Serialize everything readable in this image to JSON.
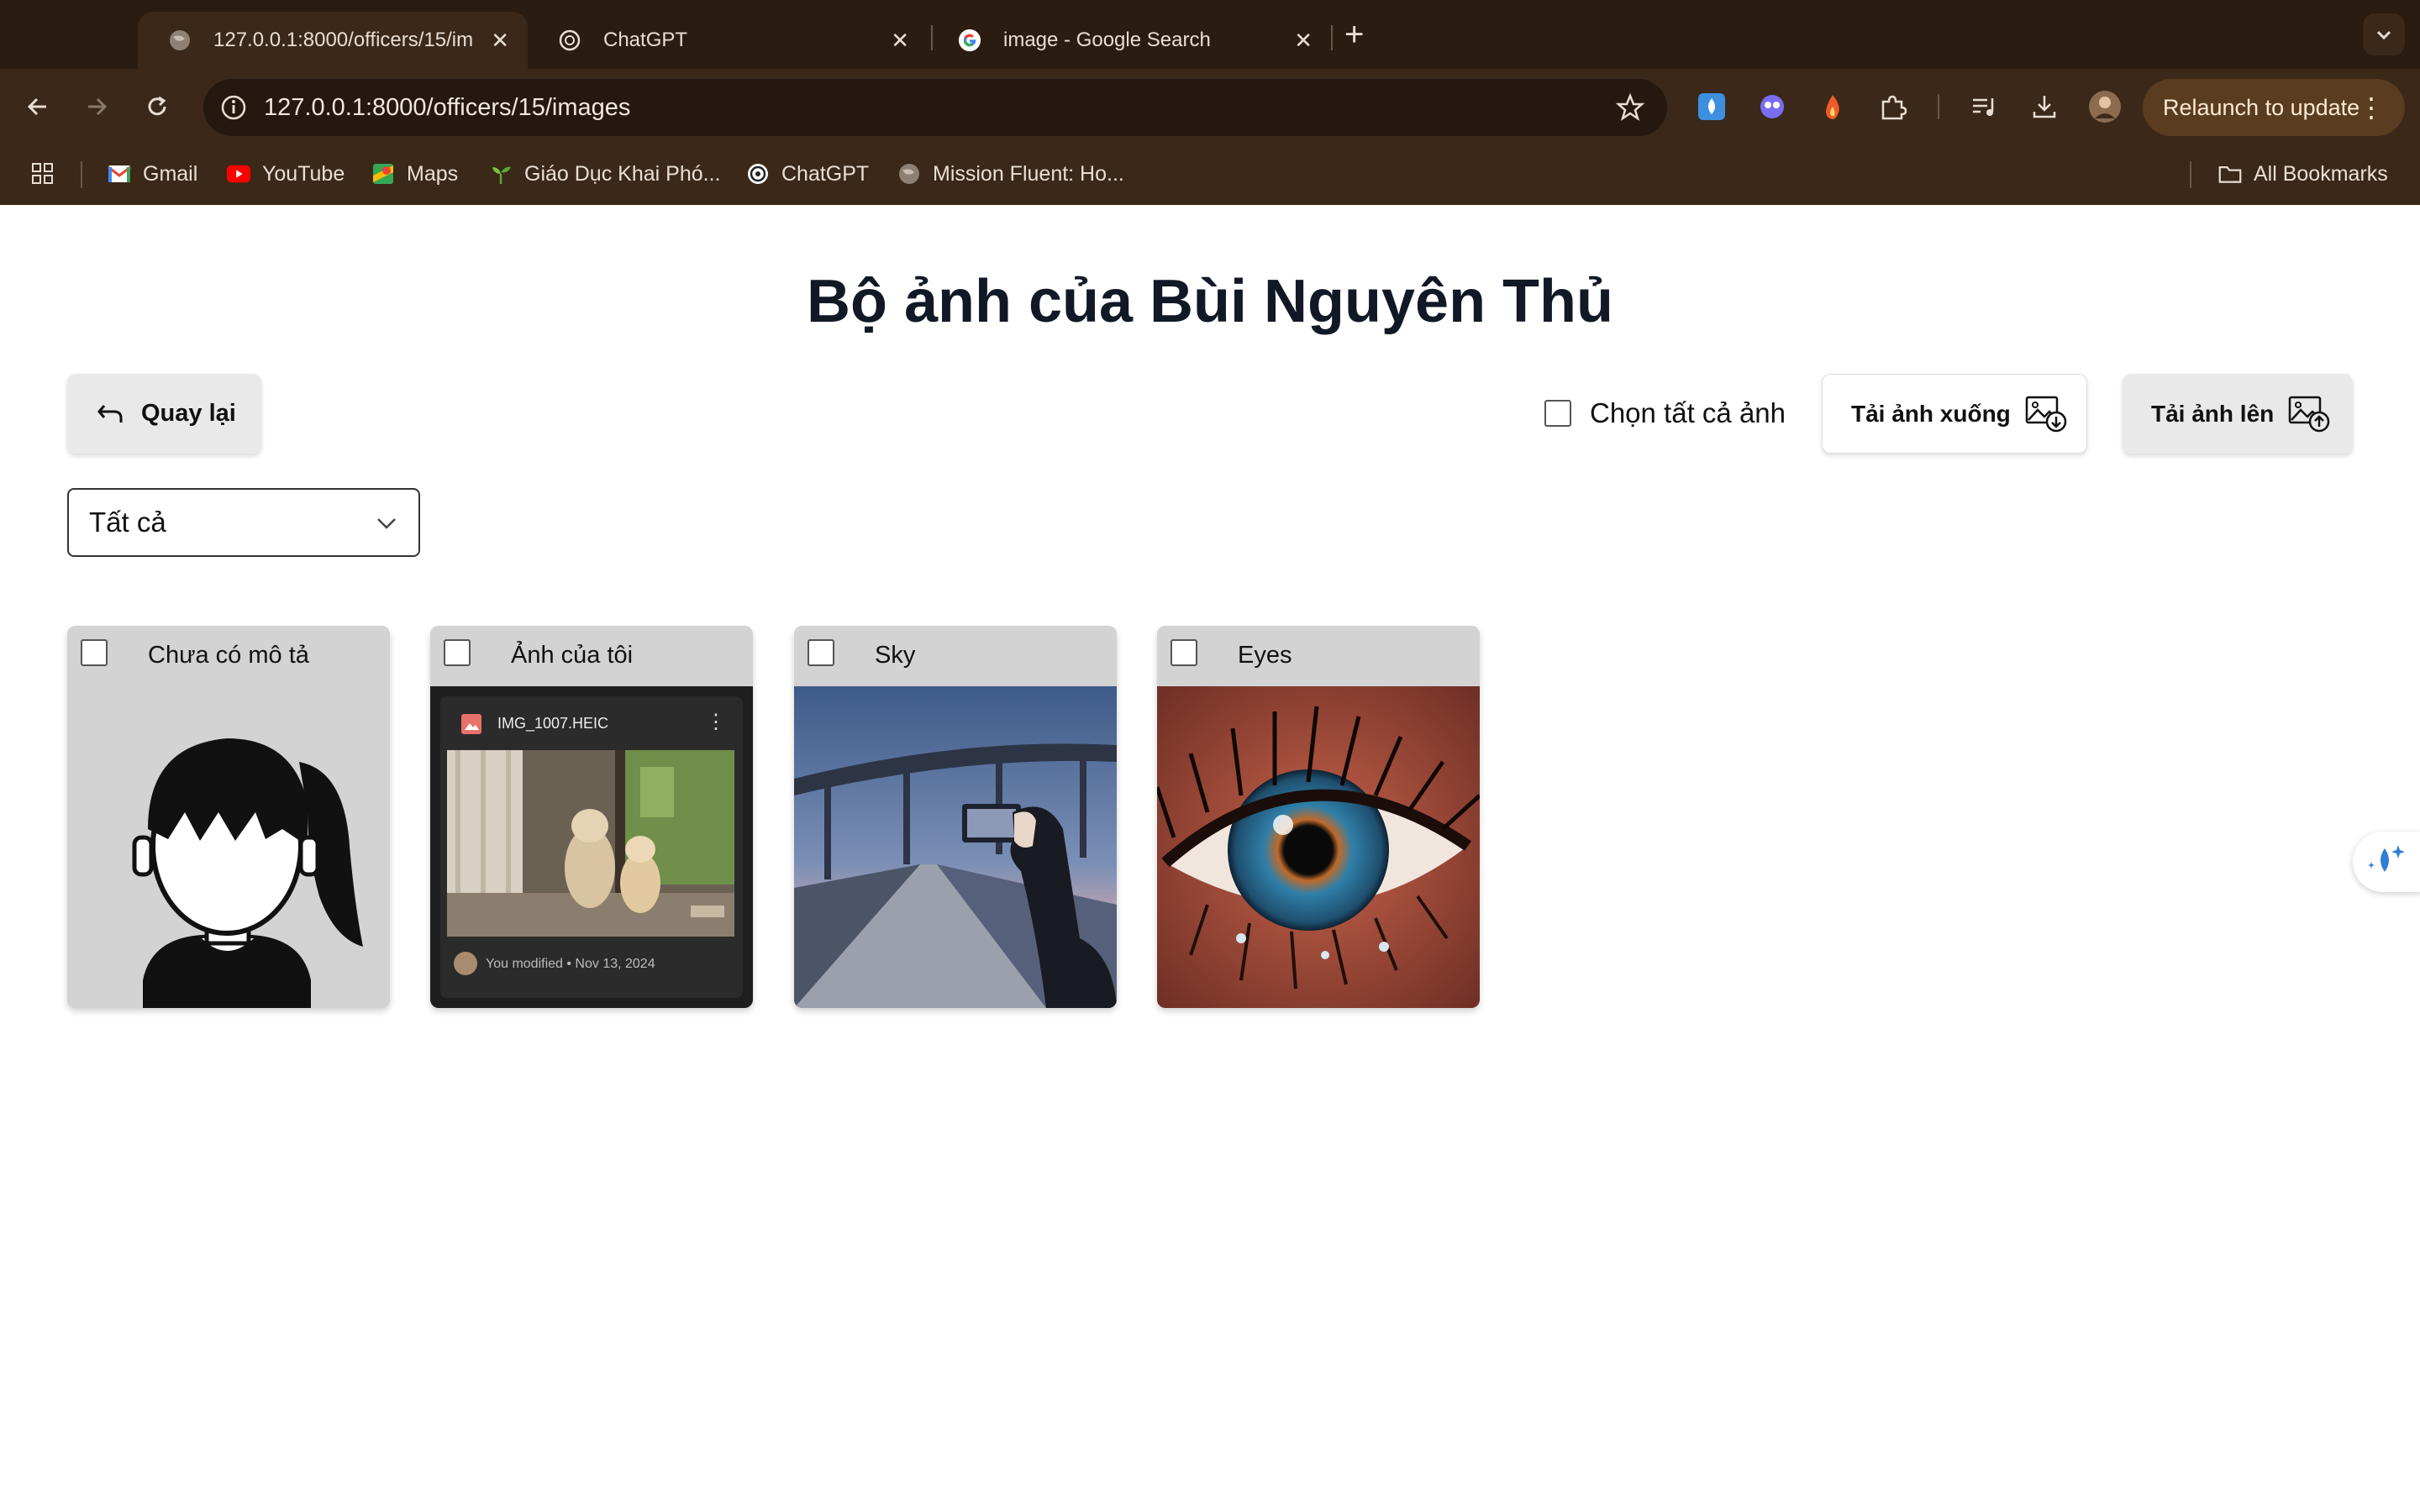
{
  "browser": {
    "tabs": [
      {
        "title": "127.0.0.1:8000/officers/15/im",
        "active": true
      },
      {
        "title": "ChatGPT",
        "active": false
      },
      {
        "title": "image - Google Search",
        "active": false
      }
    ],
    "close_glyph": "✕",
    "new_tab_glyph": "+",
    "url": "127.0.0.1:8000/officers/15/images",
    "relaunch_label": "Relaunch to update",
    "menu_glyph": "⋮",
    "bookmarks": [
      "Gmail",
      "YouTube",
      "Maps",
      "Giáo Dục Khai Phó...",
      "ChatGPT",
      "Mission Fluent: Ho..."
    ],
    "all_bookmarks": "All Bookmarks"
  },
  "page": {
    "title": "Bộ ảnh của Bùi Nguyên Thủ",
    "back_label": "Quay lại",
    "select_all_label": "Chọn tất cả ảnh",
    "download_label": "Tải ảnh xuống",
    "upload_label": "Tải ảnh lên",
    "filter_value": "Tất cả"
  },
  "cards": [
    {
      "caption": "Chưa có mô tả",
      "image": "avatar-placeholder"
    },
    {
      "caption": "Ảnh của tôi",
      "image": "drive-screenshot",
      "file_name": "IMG_1007.HEIC",
      "more_glyph": "⋮",
      "meta": "You modified • Nov 13, 2024"
    },
    {
      "caption": "Sky",
      "image": "bridge-photo"
    },
    {
      "caption": "Eyes",
      "image": "eye-photo"
    }
  ],
  "colors": {
    "chrome": "#3b2819",
    "tabstrip": "#2a1c10",
    "accent_relaunch": "#5a3d20",
    "card_bg": "#d3d3d3"
  }
}
